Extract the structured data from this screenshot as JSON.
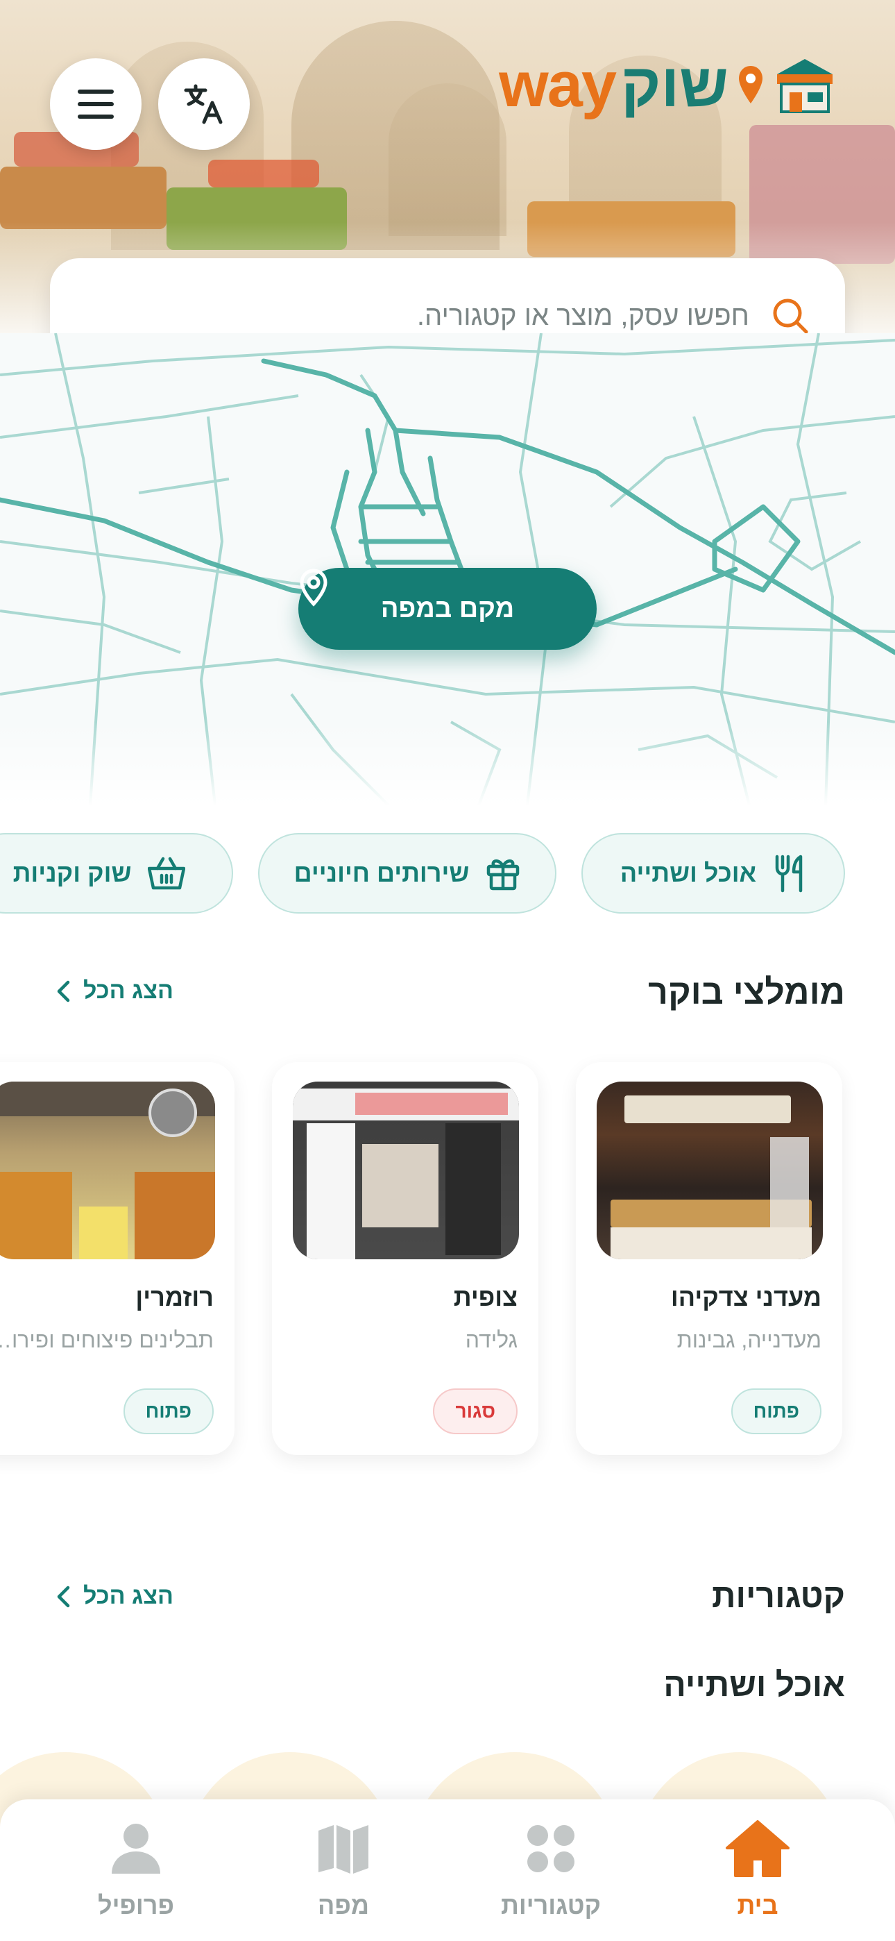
{
  "app": {
    "logo_hebrew": "שוק",
    "logo_latin": "way"
  },
  "header": {
    "menu_icon": "hamburger-menu-icon",
    "language_icon": "translate-icon"
  },
  "search": {
    "placeholder": "חפשו עסק, מוצר או קטגוריה.",
    "icon": "search-icon"
  },
  "map": {
    "button_label": "מקם במפה",
    "button_icon": "map-pin-icon"
  },
  "chips": [
    {
      "label": "אוכל ושתייה",
      "icon": "fork-knife-icon"
    },
    {
      "label": "שירותים חיוניים",
      "icon": "gift-icon"
    },
    {
      "label": "שוק וקניות",
      "icon": "basket-icon"
    }
  ],
  "recommended": {
    "title": "מומלצי בוקר",
    "see_all": "הצג הכל",
    "items": [
      {
        "name": "מעדני צדקיהו",
        "description": "מעדנייה, גבינות",
        "status": "פתוח",
        "open": true
      },
      {
        "name": "צופית",
        "description": "גלידה",
        "status": "סגור",
        "open": false
      },
      {
        "name": "רוזמרין",
        "description": "תבלינים פיצוחים ופירות יבשים",
        "status": "פתוח",
        "open": true
      }
    ]
  },
  "categories": {
    "title": "קטגוריות",
    "see_all": "הצג הכל",
    "subtitle": "אוכל ושתייה"
  },
  "bottom_nav": [
    {
      "label": "בית",
      "icon": "home-icon",
      "active": true
    },
    {
      "label": "קטגוריות",
      "icon": "grid-icon",
      "active": false
    },
    {
      "label": "מפה",
      "icon": "map-icon",
      "active": false
    },
    {
      "label": "פרופיל",
      "icon": "profile-icon",
      "active": false
    }
  ],
  "colors": {
    "primary": "#157d74",
    "accent": "#e8731a",
    "open_bg": "#eef8f6",
    "closed": "#d93a3a"
  }
}
